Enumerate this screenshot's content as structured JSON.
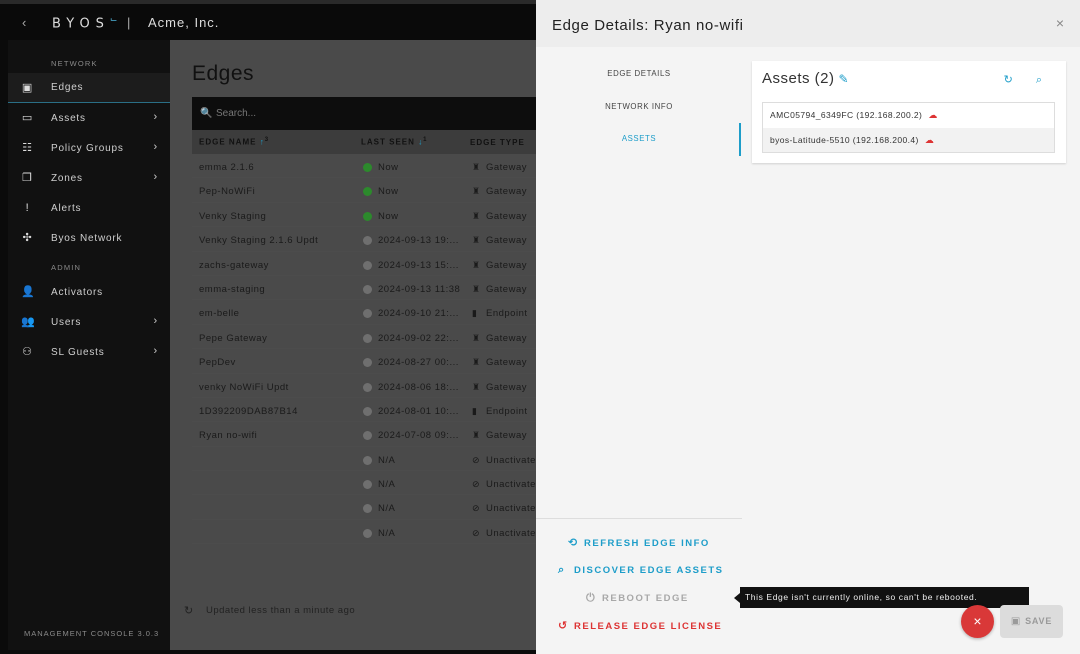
{
  "header": {
    "back": "‹",
    "logo": "BYOS",
    "logo_mark": "⌙",
    "separator": "|",
    "org": "Acme, Inc."
  },
  "sidebar": {
    "network_label": "NETWORK",
    "admin_label": "ADMIN",
    "network_items": [
      {
        "label": "Edges",
        "icon": "edges-icon",
        "glyph": "▣",
        "active": true,
        "chevron": ""
      },
      {
        "label": "Assets",
        "icon": "laptop-icon",
        "glyph": "▭",
        "chevron": "›"
      },
      {
        "label": "Policy Groups",
        "icon": "policy-icon",
        "glyph": "☷",
        "chevron": "›"
      },
      {
        "label": "Zones",
        "icon": "zones-icon",
        "glyph": "❐",
        "chevron": "›"
      },
      {
        "label": "Alerts",
        "icon": "alert-icon",
        "glyph": "!",
        "chevron": ""
      },
      {
        "label": "Byos Network",
        "icon": "network-icon",
        "glyph": "✣",
        "chevron": ""
      }
    ],
    "admin_items": [
      {
        "label": "Activators",
        "icon": "add-user-icon",
        "glyph": "👤",
        "chevron": ""
      },
      {
        "label": "Users",
        "icon": "users-icon",
        "glyph": "👥",
        "chevron": "›"
      },
      {
        "label": "SL Guests",
        "icon": "guests-icon",
        "glyph": "⚇",
        "chevron": "›"
      }
    ],
    "version": "MANAGEMENT CONSOLE 3.0.3"
  },
  "main": {
    "title": "Edges",
    "search_placeholder": "Search...",
    "search_glyph": "🔍",
    "columns": {
      "name": "EDGE NAME",
      "name_sort": "↑",
      "name_sort_index": "3",
      "seen": "LAST SEEN",
      "seen_sort": "↓",
      "seen_sort_index": "1",
      "type": "EDGE TYPE"
    },
    "rows": [
      {
        "name": "emma 2.1.6",
        "seen": "Now",
        "status": "green",
        "type": "Gateway",
        "tglyph": "♜"
      },
      {
        "name": "Pep-NoWiFi",
        "seen": "Now",
        "status": "green",
        "type": "Gateway",
        "tglyph": "♜"
      },
      {
        "name": "Venky Staging",
        "seen": "Now",
        "status": "green",
        "type": "Gateway",
        "tglyph": "♜"
      },
      {
        "name": "Venky Staging 2.1.6 Updt",
        "seen": "2024-09-13 19:...",
        "status": "gray",
        "type": "Gateway",
        "tglyph": "♜"
      },
      {
        "name": "zachs-gateway",
        "seen": "2024-09-13 15:...",
        "status": "gray",
        "type": "Gateway",
        "tglyph": "♜"
      },
      {
        "name": "emma-staging",
        "seen": "2024-09-13 11:38",
        "status": "gray",
        "type": "Gateway",
        "tglyph": "♜"
      },
      {
        "name": "em-belle",
        "seen": "2024-09-10 21:...",
        "status": "gray",
        "type": "Endpoint",
        "tglyph": "▮"
      },
      {
        "name": "Pepe Gateway",
        "seen": "2024-09-02 22:...",
        "status": "gray",
        "type": "Gateway",
        "tglyph": "♜"
      },
      {
        "name": "PepDev",
        "seen": "2024-08-27 00:...",
        "status": "gray",
        "type": "Gateway",
        "tglyph": "♜"
      },
      {
        "name": "venky NoWiFi Updt",
        "seen": "2024-08-06 18:...",
        "status": "gray",
        "type": "Gateway",
        "tglyph": "♜"
      },
      {
        "name": "1D392209DAB87B14",
        "seen": "2024-08-01 10:...",
        "status": "gray",
        "type": "Endpoint",
        "tglyph": "▮"
      },
      {
        "name": "Ryan no-wifi",
        "seen": "2024-07-08 09:...",
        "status": "gray",
        "type": "Gateway",
        "tglyph": "♜"
      },
      {
        "name": "",
        "seen": "N/A",
        "status": "gray",
        "type": "Unactivated",
        "tglyph": "⊘"
      },
      {
        "name": "",
        "seen": "N/A",
        "status": "gray",
        "type": "Unactivated",
        "tglyph": "⊘"
      },
      {
        "name": "",
        "seen": "N/A",
        "status": "gray",
        "type": "Unactivated",
        "tglyph": "⊘"
      },
      {
        "name": "",
        "seen": "N/A",
        "status": "gray",
        "type": "Unactivated",
        "tglyph": "⊘"
      }
    ],
    "updated_text": "Updated less than a minute ago",
    "updated_glyph": "↻"
  },
  "drawer": {
    "title": "Edge Details: Ryan no-wifi",
    "close": "×",
    "tabs": [
      "EDGE DETAILS",
      "NETWORK INFO",
      "ASSETS"
    ],
    "active_tab": "ASSETS",
    "actions": {
      "refresh": "REFRESH EDGE INFO",
      "discover": "DISCOVER EDGE ASSETS",
      "reboot": "REBOOT EDGE",
      "release": "RELEASE EDGE LICENSE"
    },
    "action_glyphs": {
      "refresh": "⟲",
      "discover": "⌕",
      "reboot": "⏻",
      "release": "↺"
    },
    "assets": {
      "title": "Assets (2)",
      "edit_glyph": "✎",
      "tools_glyph": "↻ ⌕",
      "cloud_glyph": "☁",
      "items": [
        {
          "label": "AMC05794_6349FC (192.168.200.2)",
          "icon": "cloud-offline-icon"
        },
        {
          "label": "byos-Latitude-5510 (192.168.200.4)",
          "icon": "cloud-offline-icon"
        }
      ]
    },
    "tooltip": "This Edge isn't currently online, so can't be rebooted.",
    "fab_glyph": "×",
    "save_label": "SAVE"
  },
  "colors": {
    "accent": "#1d9dc9",
    "danger": "#d93838",
    "online": "#2c8a2c",
    "offline": "#6f6f6f"
  }
}
